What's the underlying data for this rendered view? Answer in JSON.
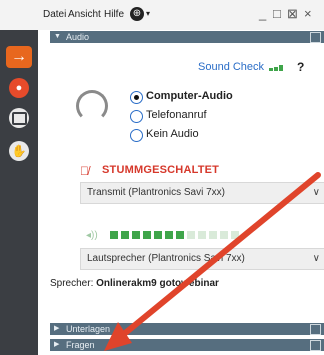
{
  "menubar": {
    "items": [
      "Datei",
      "Ansicht",
      "Hilfe"
    ],
    "language_icon": "globe-icon",
    "window_controls": [
      "_",
      "□",
      "⊠",
      "×"
    ]
  },
  "audio_section": {
    "title": "Audio",
    "sound_check_label": "Sound Check",
    "help_label": "?",
    "options": [
      {
        "label": "Computer-Audio",
        "selected": true
      },
      {
        "label": "Telefonanruf",
        "selected": false
      },
      {
        "label": "Kein Audio",
        "selected": false
      }
    ],
    "mute_status": "STUMMGESCHALTET",
    "transmit_device": "Transmit (Plantronics Savi 7xx)",
    "speaker_device": "Lautsprecher (Plantronics Savi 7xx)",
    "speaker_level": 0.55,
    "speaker_label": "Sprecher:",
    "speaker_name": "Onlinerakm9 gotowebinar"
  },
  "collapsed_sections": [
    "Unterlagen",
    "Fragen"
  ],
  "colors": {
    "section_header": "#566e7f",
    "accent_orange": "#e8671e",
    "mute_red": "#d6382b",
    "link_blue": "#2a6dc7",
    "level_green": "#3fa54a",
    "annotation_arrow": "#e0442b"
  }
}
